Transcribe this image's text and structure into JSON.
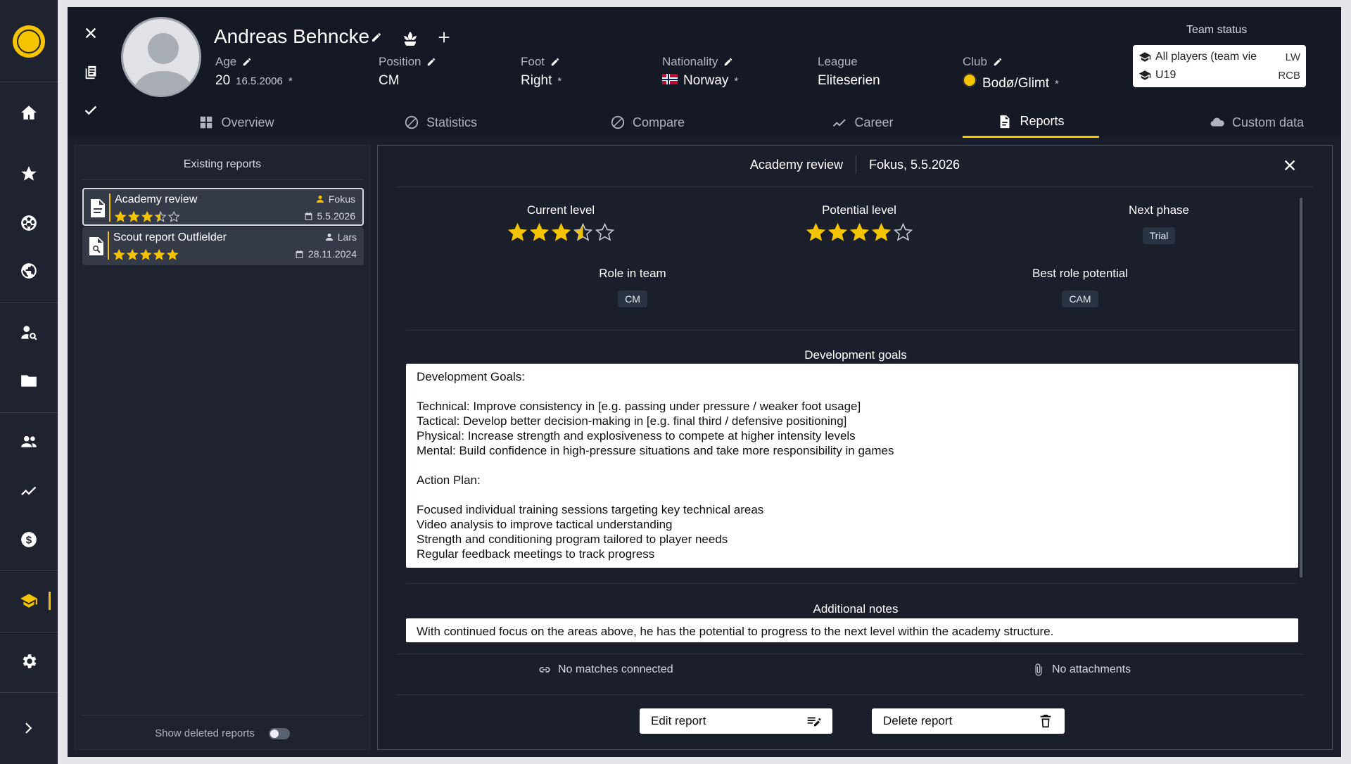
{
  "player": {
    "name": "Andreas Behncke",
    "age_label": "Age",
    "age": "20",
    "birthdate": "16.5.2006",
    "position_label": "Position",
    "position": "CM",
    "foot_label": "Foot",
    "foot": "Right",
    "nationality_label": "Nationality",
    "nationality": "Norway",
    "league_label": "League",
    "league": "Eliteserien",
    "club_label": "Club",
    "club": "Bodø/Glimt",
    "derived_marker": "*"
  },
  "team_status": {
    "title": "Team status",
    "rows": [
      {
        "team": "All players (team vie",
        "pos": "LW"
      },
      {
        "team": "U19",
        "pos": "RCB"
      }
    ]
  },
  "tabs": [
    {
      "label": "Overview",
      "icon": "grid-icon"
    },
    {
      "label": "Statistics",
      "icon": "slash-circle-icon"
    },
    {
      "label": "Compare",
      "icon": "slash-circle-icon"
    },
    {
      "label": "Career",
      "icon": "trend-icon"
    },
    {
      "label": "Reports",
      "icon": "document-icon",
      "active": true
    },
    {
      "label": "Custom data",
      "icon": "cloud-icon"
    }
  ],
  "reports_panel": {
    "title": "Existing reports",
    "items": [
      {
        "title": "Academy review",
        "author": "Fokus",
        "date": "5.5.2026",
        "rating": 3.5,
        "selected": true
      },
      {
        "title": "Scout report Outfielder",
        "author": "Lars",
        "date": "28.11.2024",
        "rating": 5
      }
    ],
    "show_deleted_label": "Show deleted reports",
    "show_deleted": false
  },
  "report": {
    "type": "Academy review",
    "author_date": "Fokus, 5.5.2026",
    "current_level_label": "Current level",
    "current_level": 3.5,
    "potential_level_label": "Potential level",
    "potential_level": 4,
    "next_phase_label": "Next phase",
    "next_phase": "Trial",
    "role_label": "Role in team",
    "role": "CM",
    "best_role_label": "Best role potential",
    "best_role": "CAM",
    "dev_goals_title": "Development goals",
    "dev_goals_text": "Development Goals:\n\nTechnical: Improve consistency in [e.g. passing under pressure / weaker foot usage]\nTactical: Develop better decision-making in [e.g. final third / defensive positioning]\nPhysical: Increase strength and explosiveness to compete at higher intensity levels\nMental: Build confidence in high-pressure situations and take more responsibility in games\n\nAction Plan:\n\nFocused individual training sessions targeting key technical areas\nVideo analysis to improve tactical understanding\nStrength and conditioning program tailored to player needs\nRegular feedback meetings to track progress",
    "notes_title": "Additional notes",
    "notes_text": "With continued focus on the areas above, he has the potential to progress to the next level within the academy structure.",
    "matches_label": "No matches connected",
    "attachments_label": "No attachments",
    "edit_label": "Edit report",
    "delete_label": "Delete report"
  },
  "colors": {
    "accent": "#f5c400",
    "nav_bg": "#1f2330",
    "panel_bg": "#1b1f2b",
    "header_bg": "#151925"
  }
}
